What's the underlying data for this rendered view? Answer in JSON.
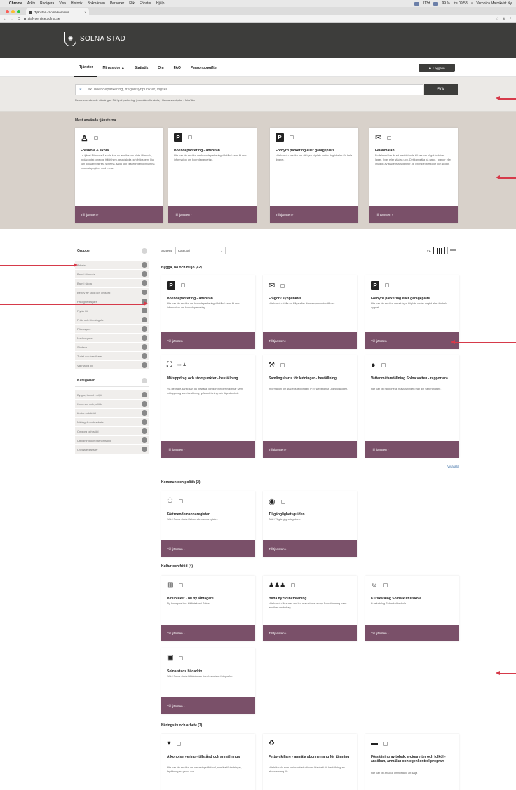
{
  "menubar": {
    "app": "Chrome",
    "items": [
      "Arkiv",
      "Redigera",
      "Visa",
      "Historik",
      "Bokmärken",
      "Personer",
      "Flik",
      "Fönster",
      "Hjälp"
    ],
    "status": [
      "113d",
      "99 %",
      "fre 09:58"
    ],
    "user": "Veronica Malmkvist Ny"
  },
  "browser": {
    "tab_title": "Tjänster - Solna kommun",
    "url": "sjalvservice.solna.se"
  },
  "header": {
    "brand": "SOLNA STAD",
    "nav": [
      "Tjänster",
      "Mina sidor ▲",
      "Statistik",
      "Om",
      "FAQ",
      "Personuppgifter"
    ],
    "login": "Logga in"
  },
  "search": {
    "placeholder": "T.ex. boendeparkering, frågor/synpunkter, vigsel",
    "button": "Sök",
    "suggestions": "Rekommenderade sökningar: Förhyrd parkering, | anmälan förskola, | lämna samtycke - foto/film"
  },
  "popular": {
    "heading": "Mest använda tjänsterna",
    "cards": [
      {
        "icon": "child-icon",
        "title": "Förskola & skola",
        "desc": "I e-tjänst Förskola & skola kan du ansöka om plats i förskola, pedagogisk omsorg, fritidshem, grundskola och fritidshem. Du kan också registrera schema, säga upp placeringen och lämna inkomstuppgifter med mera.",
        "cta": "Till tjänsten ›"
      },
      {
        "icon": "parking-icon",
        "title": "Boendeparkering - ansökan",
        "desc": "Här kan du ansöka om boendeparkeringstillstånd samt få mer information om boendeparkering.",
        "cta": "Till tjänsten ›"
      },
      {
        "icon": "parking-icon",
        "title": "Förhyrd parkering eller garageplats",
        "desc": "Här kan du ansöka om att hyra köplats under dagtid eller för hela dygnet.",
        "cta": "Till tjänsten ›"
      },
      {
        "icon": "mail-icon",
        "title": "Felanmälan",
        "desc": "En felanmälan är ett meddelande till oss om något behöver lagas, fixas eller städas upp. Det kan gälla på gator, i parker eller i någon av stadens fastigheter, till exempel förskolor och skolor.",
        "cta": "Till tjänsten ›"
      }
    ]
  },
  "sidebar": {
    "groups_heading": "Grupper",
    "groups": [
      "Arbeta",
      "Barn i förskola",
      "Barn i skola",
      "Behov av stöd och omsorg",
      "Fastighetsägare",
      "Flytta hit",
      "Fritid och föreningsliv",
      "Företagare",
      "Medborgare",
      "Studera",
      "Turist och besökare",
      "Vill hjälpa till"
    ],
    "categories_heading": "Kategorier",
    "categories": [
      "Bygga, bo och miljö",
      "Kommun och politik",
      "Kultur och fritid",
      "Näringsliv och arbete",
      "Omsorg och stöd",
      "Utbildning och barnomsorg",
      "Övriga e-tjänster"
    ]
  },
  "main": {
    "sort_label": "Sortera:",
    "sort_value": "Kategori",
    "view_label": "Vy:",
    "show_all": "Visa alla",
    "sections": [
      {
        "title": "Bygga, bo och miljö (42)"
      },
      {
        "title": "Kommun och politik (2)"
      },
      {
        "title": "Kultur och fritid (4)"
      },
      {
        "title": "Näringsliv och arbete (7)"
      }
    ],
    "cards": [
      {
        "icon": "parking-icon",
        "title": "Boendeparkering - ansökan",
        "desc": "Här kan du ansöka om boendeparkeringstillstånd samt få mer information om boendeparkering.",
        "cta": "Till tjänsten ›"
      },
      {
        "icon": "mail-icon",
        "title": "Frågor / synpunkter",
        "desc": "Här kan du ställa en fråga eller lämna synpunkter till oss.",
        "cta": "Till tjänsten ›"
      },
      {
        "icon": "parking-icon",
        "title": "Förhyrd parkering eller garageplats",
        "desc": "Här kan du ansöka om att hyra köplats under dagtid eller för hela dygnet.",
        "cta": "Till tjänsten ›"
      },
      {
        "icon": "survey-icon",
        "title": "Mätuppdrag och stompunkter - beställning",
        "desc": "Via denna e-tjänst kan du beställa polygonpunkter/höjdfixar samt mätuppdrag som inmätning, gränsutvisning och lägeskontroll.",
        "cta": "Till tjänsten ›"
      },
      {
        "icon": "worker-icon",
        "title": "Samlingskarta för ledningar - beställning",
        "desc": "Information om stadens ledningar i PTS webbtjänst Ledningskollen.",
        "cta": "Till tjänsten ›"
      },
      {
        "icon": "water-drop-icon",
        "title": "Vattenmätarställning Solna vatten - rapportera",
        "desc": "Här kan du rapportera in avläsningen från din vattenmätare.",
        "cta": "Till tjänsten ›"
      },
      {
        "icon": "handshake-icon",
        "title": "Förtroendemannaregister",
        "desc": "Sök i Solna stads förtroendemannaregister.",
        "cta": "Till tjänsten ›"
      },
      {
        "icon": "accessibility-icon",
        "title": "Tillgänglighetsguiden",
        "desc": "Sök i Tillgänglighetsguiden.",
        "cta": "Till tjänsten ›"
      },
      {
        "icon": "library-icon",
        "title": "Biblioteket - bli ny låntagare",
        "desc": "Ny låntagare hos biblioteken i Solna.",
        "cta": "Till tjänsten ›"
      },
      {
        "icon": "group-icon",
        "title": "Bilda ny Solnaförening",
        "desc": "Här kan du läsa mer om hur man startar en ny Solnaförening samt ansöker om bidrag.",
        "cta": "Till tjänsten ›"
      },
      {
        "icon": "theatre-icon",
        "title": "Kurskatalog Solna kulturskola",
        "desc": "Kurskatalog Solna kulturskola.",
        "cta": "Till tjänsten ›"
      },
      {
        "icon": "image-icon",
        "title": "Solna stads bildarkiv",
        "desc": "Sök i Solna stads bilddatabas över historiska fotografier.",
        "cta": "Till tjänsten ›"
      },
      {
        "icon": "glass-icon",
        "title": "Alkoholservering - tillstånd och anmälningar",
        "desc": "Här kan du ansöka om serveringstillstånd, anmäla förändringar, kryddning av grava och",
        "cta": "Till tjänsten ›"
      },
      {
        "icon": "recycle-icon",
        "title": "Fettavskiljare - anmäla abonnemang för tömning",
        "desc": "Här hittar du som verksamhetsutövare blankett för beställning av abonnemang för",
        "cta": "Till tjänsten ›"
      },
      {
        "icon": "cigarette-icon",
        "title": "Försäljning av tobak, e-cigaretter och folköl - ansökan, anmälan och egenkontrollprogram",
        "desc": "Här kan du ansöka om tillstånd att sälja",
        "cta": "Till tjänsten ›"
      }
    ]
  },
  "colors": {
    "header": "#3d3d3b",
    "accent": "#7a5069",
    "arrow": "#d63a4a"
  }
}
